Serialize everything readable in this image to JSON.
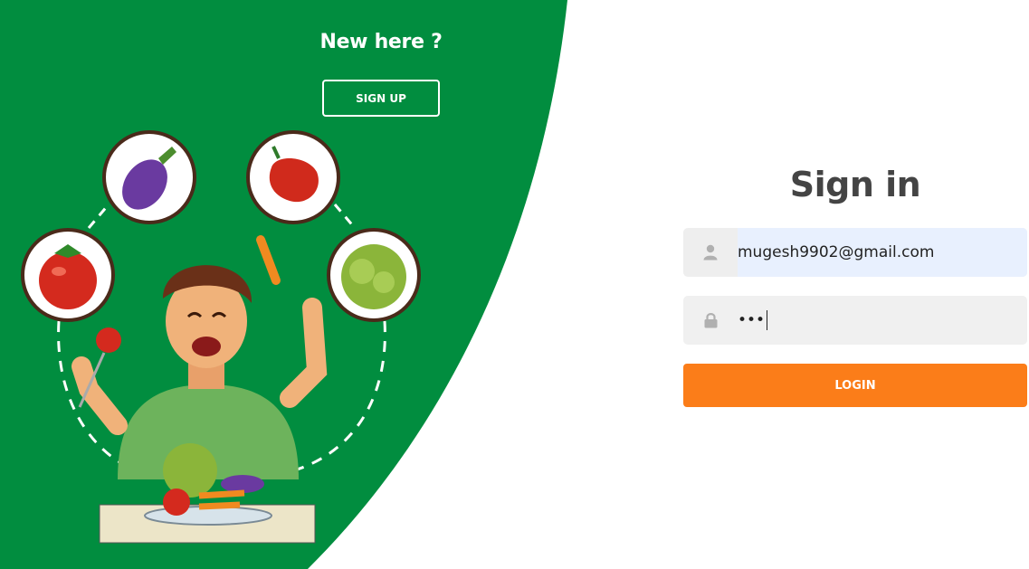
{
  "left_panel": {
    "heading": "New here ?",
    "signup_label": "SIGN UP",
    "background_color": "#018d3f"
  },
  "form": {
    "title": "Sign in",
    "username": {
      "value": "mugesh9902@gmail.com",
      "icon": "user-icon"
    },
    "password": {
      "masked_value": "•••",
      "icon": "lock-icon"
    },
    "login_label": "LOGIN",
    "accent_color": "#fb7d19"
  }
}
